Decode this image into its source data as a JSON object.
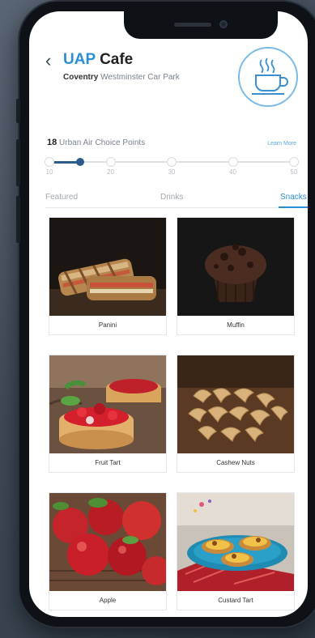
{
  "header": {
    "back_glyph": "‹",
    "brand": "UAP",
    "title": "Cafe",
    "location_bold": "Coventry",
    "location": "Westminster Car Park",
    "logo_icon": "coffee-cup-icon"
  },
  "points": {
    "value": "18",
    "label": "Urban Air Choice Points",
    "learn_more": "Learn More",
    "current_level": 0.125,
    "ticks": [
      "10",
      "20",
      "30",
      "40",
      "50"
    ]
  },
  "tabs": [
    {
      "label": "Featured",
      "active": false
    },
    {
      "label": "Drinks",
      "active": false
    },
    {
      "label": "Snacks",
      "active": true
    }
  ],
  "products": [
    {
      "name": "Panini"
    },
    {
      "name": "Muffin"
    },
    {
      "name": "Fruit Tart"
    },
    {
      "name": "Cashew Nuts"
    },
    {
      "name": "Apple"
    },
    {
      "name": "Custard Tart"
    }
  ],
  "colors": {
    "accent": "#2a8fd6",
    "slider_fill": "#2c5c8f"
  }
}
